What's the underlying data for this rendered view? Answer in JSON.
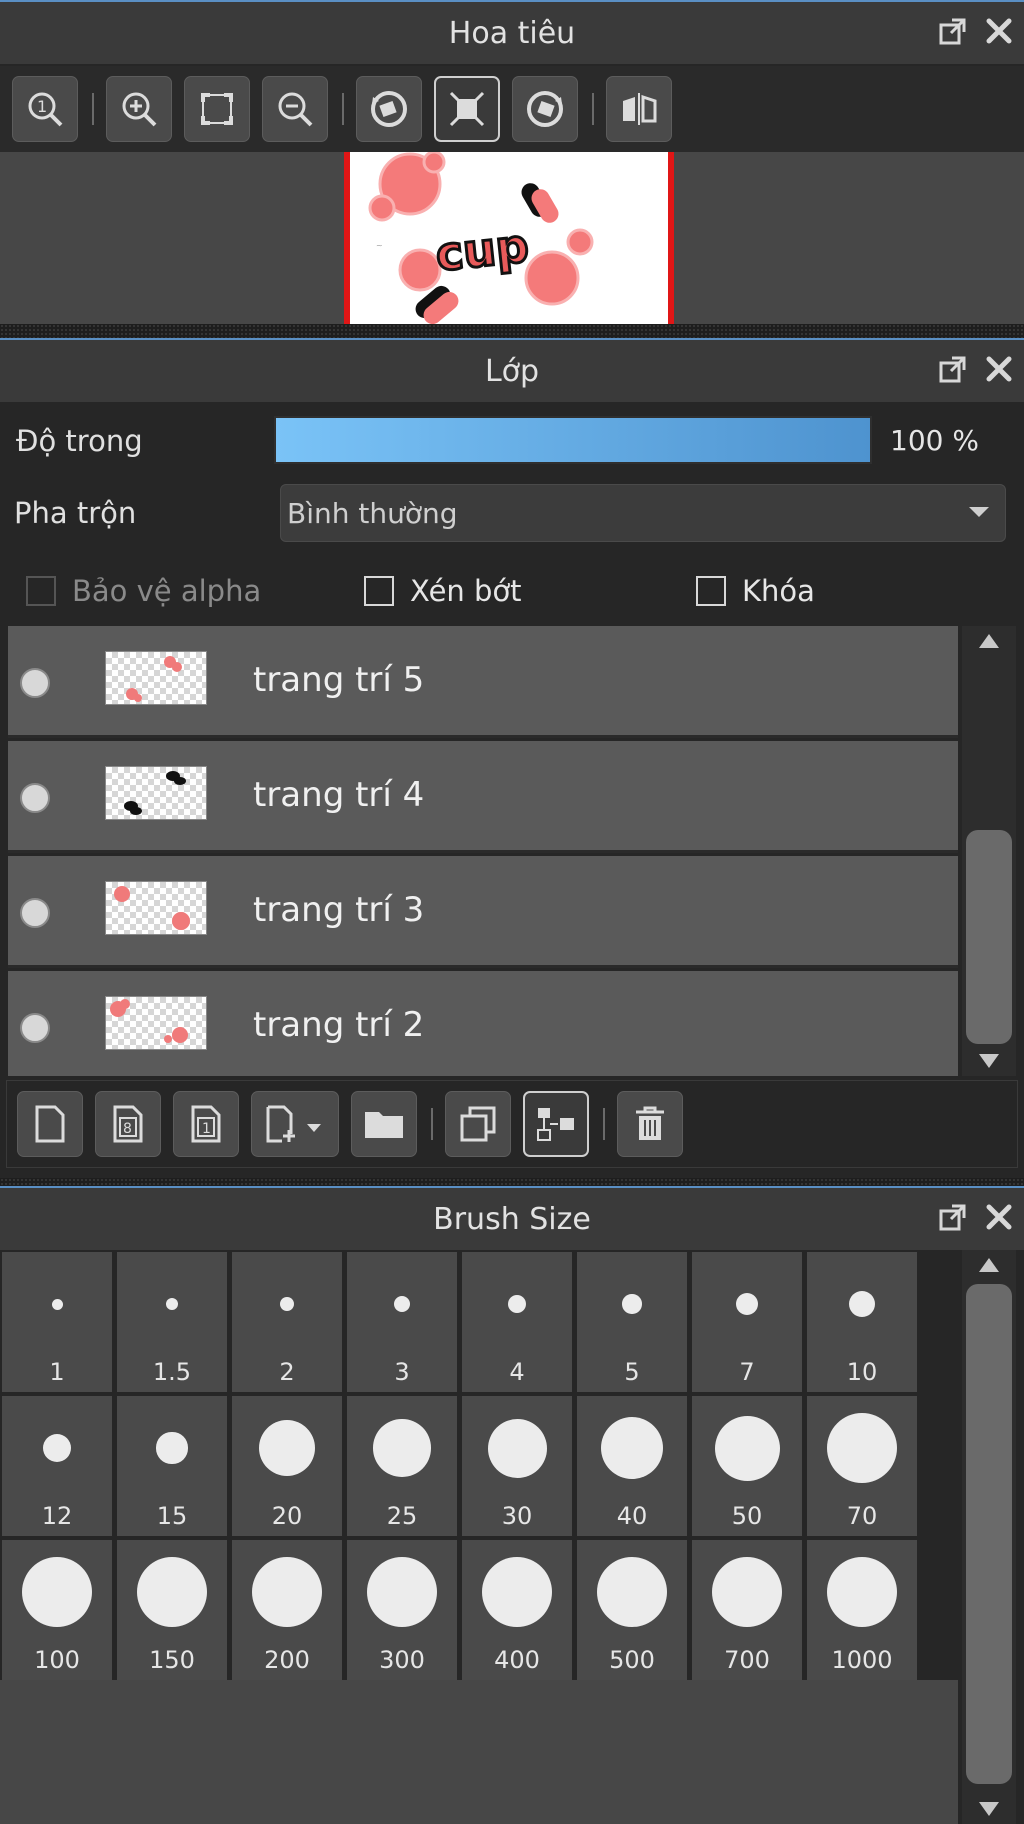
{
  "navigator": {
    "title": "Hoa tiêu",
    "toolbar": [
      "zoom-actual-icon",
      "zoom-in-icon",
      "fit-screen-icon",
      "zoom-out-icon",
      "rotate-left-icon",
      "reset-view-icon",
      "rotate-right-icon",
      "flip-horizontal-icon"
    ],
    "preview_text": "cup"
  },
  "layers": {
    "title": "Lớp",
    "opacity_label": "Độ trong",
    "opacity_value": "100 %",
    "opacity_percent": 100,
    "blend_label": "Pha trộn",
    "blend_value": "Bình thường",
    "protect_alpha_label": "Bảo vệ alpha",
    "clip_label": "Xén bớt",
    "lock_label": "Khóa",
    "items": [
      {
        "name": "trang trí 5"
      },
      {
        "name": "trang trí 4"
      },
      {
        "name": "trang trí 3"
      },
      {
        "name": "trang trí 2"
      }
    ],
    "toolbar": [
      "new-layer-icon",
      "new-8bit-layer-icon",
      "new-1bit-layer-icon",
      "add-layer-menu-icon",
      "new-folder-icon",
      "duplicate-layer-icon",
      "merge-down-icon",
      "delete-layer-icon"
    ]
  },
  "brush_size": {
    "title": "Brush Size",
    "sizes": [
      "1",
      "1.5",
      "2",
      "3",
      "4",
      "5",
      "7",
      "10",
      "12",
      "15",
      "20",
      "25",
      "30",
      "40",
      "50",
      "70",
      "100",
      "150",
      "200",
      "300",
      "400",
      "500",
      "700",
      "1000"
    ]
  },
  "colors": {
    "accent": "#5a8fc4",
    "opacity_fill_start": "#7ac3f7",
    "opacity_fill_end": "#4e93cf",
    "frame_red": "#e01616",
    "pink": "#f07a7a"
  }
}
